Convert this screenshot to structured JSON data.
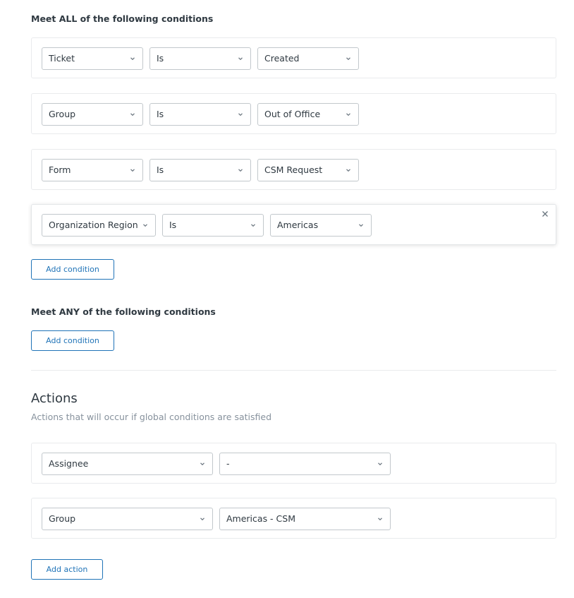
{
  "all_conditions": {
    "heading": "Meet ALL of the following conditions",
    "rows": [
      {
        "field": "Ticket",
        "operator": "Is",
        "value": "Created"
      },
      {
        "field": "Group",
        "operator": "Is",
        "value": "Out of Office"
      },
      {
        "field": "Form",
        "operator": "Is",
        "value": "CSM Request"
      },
      {
        "field": "Organization Region",
        "operator": "Is",
        "value": "Americas"
      }
    ],
    "add_label": "Add condition"
  },
  "any_conditions": {
    "heading": "Meet ANY of the following conditions",
    "add_label": "Add condition"
  },
  "actions": {
    "title": "Actions",
    "subtitle": "Actions that will occur if global conditions are satisfied",
    "rows": [
      {
        "field": "Assignee",
        "value": "-"
      },
      {
        "field": "Group",
        "value": "Americas - CSM"
      }
    ],
    "add_label": "Add action"
  },
  "icons": {
    "dropdown": "chevron-down-icon",
    "remove": "close-icon"
  },
  "colors": {
    "accent": "#1f73b7",
    "text": "#2f3941",
    "muted": "#87929d",
    "border": "#c2c8cc"
  }
}
